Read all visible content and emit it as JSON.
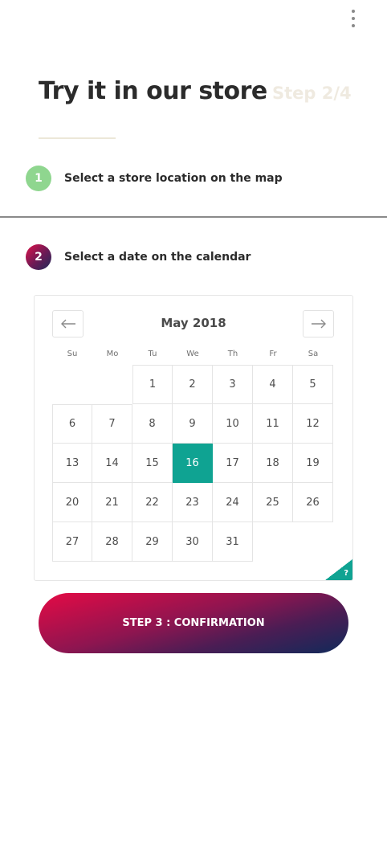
{
  "header": {
    "title": "Try it in our store",
    "step_indicator": "Step 2/4",
    "menu_icon": "more-vertical-icon"
  },
  "steps": [
    {
      "number": "1",
      "label": "Select a store location on the map",
      "color": "#8fd68f"
    },
    {
      "number": "2",
      "label": "Select a date on the calendar",
      "color": "#e0124a"
    }
  ],
  "calendar": {
    "month": "May 2018",
    "prev_icon": "arrow-left-icon",
    "next_icon": "arrow-right-icon",
    "weekdays": [
      "Su",
      "Mo",
      "Tu",
      "We",
      "Th",
      "Fr",
      "Sa"
    ],
    "days": [
      "",
      "",
      "1",
      "2",
      "3",
      "4",
      "5",
      "6",
      "7",
      "8",
      "9",
      "10",
      "11",
      "12",
      "13",
      "14",
      "15",
      "16",
      "17",
      "18",
      "19",
      "20",
      "21",
      "22",
      "23",
      "24",
      "25",
      "26",
      "27",
      "28",
      "29",
      "30",
      "31"
    ],
    "selected_day": "16",
    "selected_color": "#0fa392",
    "help_label": "?"
  },
  "cta": {
    "label": "STEP 3 : CONFIRMATION"
  }
}
